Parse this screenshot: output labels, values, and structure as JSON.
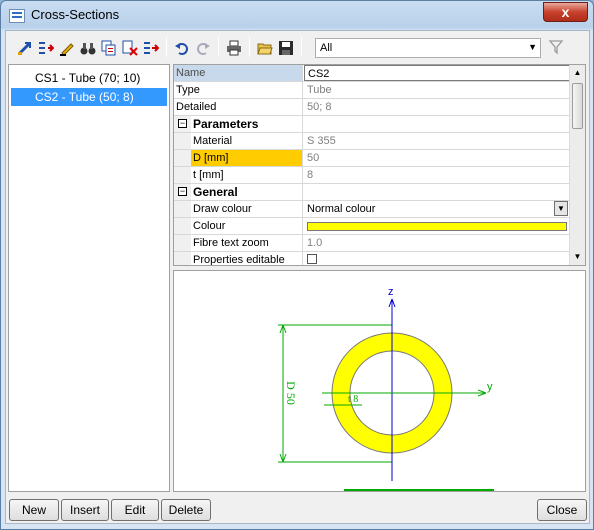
{
  "window": {
    "title": "Cross-Sections",
    "close_symbol": "x"
  },
  "toolbar": {
    "icons": [
      "add-section-icon",
      "insert-icon",
      "edit-icon",
      "binoculars-icon",
      "copy-icon",
      "delete-icon",
      "export-icon",
      "undo-icon",
      "redo-icon",
      "print-icon",
      "open-folder-icon",
      "save-icon"
    ],
    "filter_value": "All",
    "filter_icon": "funnel-icon"
  },
  "list": {
    "items": [
      {
        "label": "CS1 - Tube (70; 10)",
        "selected": false
      },
      {
        "label": "CS2 - Tube (50; 8)",
        "selected": true
      }
    ]
  },
  "properties": {
    "name_label": "Name",
    "name_value": "CS2",
    "type_label": "Type",
    "type_value": "Tube",
    "detailed_label": "Detailed",
    "detailed_value": "50; 8",
    "parameters_header": "Parameters",
    "material_label": "Material",
    "material_value": "S 355",
    "d_label": "D [mm]",
    "d_value": "50",
    "t_label": "t [mm]",
    "t_value": "8",
    "general_header": "General",
    "draw_colour_label": "Draw colour",
    "draw_colour_value": "Normal colour",
    "colour_label": "Colour",
    "colour_value_hex": "#ffff00",
    "fibre_label": "Fibre text zoom",
    "fibre_value": "1.0",
    "editable_label": "Properties editable",
    "collapse_symbol": "−"
  },
  "drawing": {
    "z_axis_label": "z",
    "y_axis_label": "y",
    "diameter_label": "D 50",
    "thickness_label": "t 8",
    "tube_color": "#ffff00",
    "axis_color": "#0000cc",
    "dimension_color": "#00aa00"
  },
  "buttons": {
    "new": "New",
    "insert": "Insert",
    "edit": "Edit",
    "delete": "Delete",
    "close": "Close"
  }
}
